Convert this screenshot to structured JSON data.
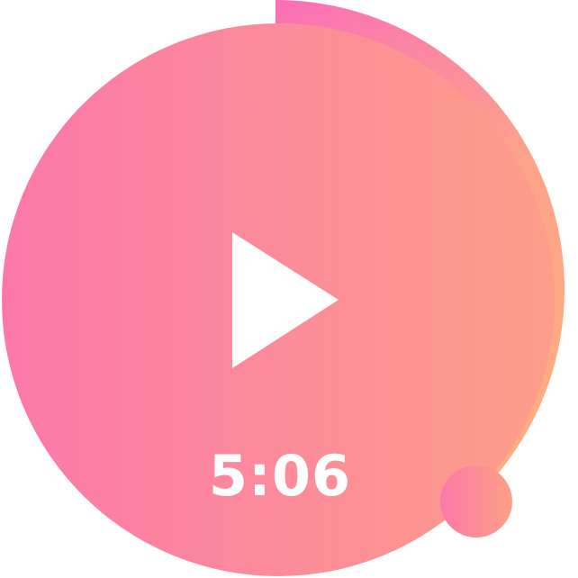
{
  "player": {
    "elapsed_time": "5:06",
    "progress_fraction": 0.37,
    "state": "paused",
    "play_icon": "play-icon"
  },
  "colors": {
    "gradient_start": "#FB78A9",
    "gradient_end": "#FDAA7F",
    "icon_color": "#FFFFFF"
  }
}
